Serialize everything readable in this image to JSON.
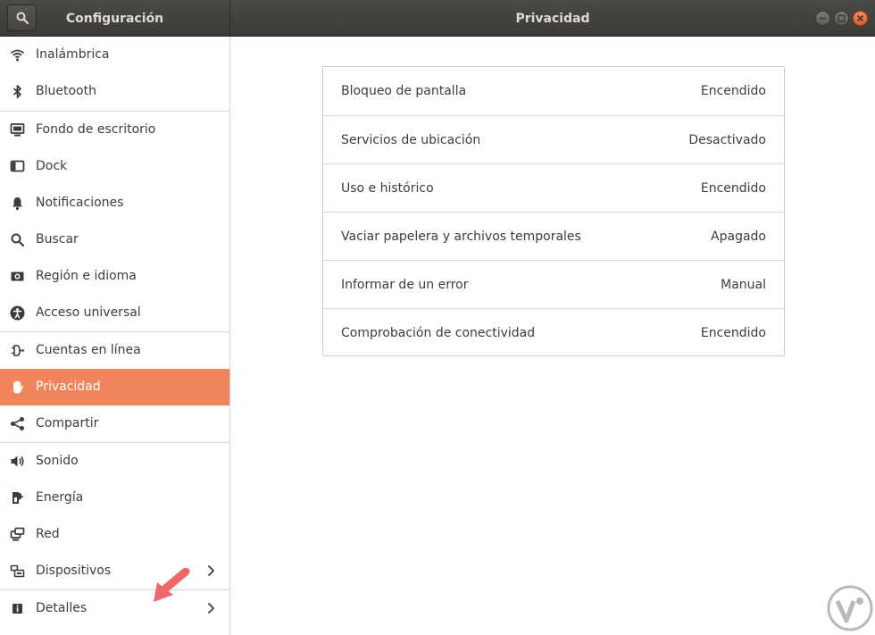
{
  "header": {
    "app_title": "Configuración",
    "panel_title": "Privacidad"
  },
  "sidebar": {
    "items": [
      {
        "label": "Inalámbrica",
        "icon": "wifi-icon"
      },
      {
        "label": "Bluetooth",
        "icon": "bluetooth-icon"
      },
      {
        "label": "Fondo de escritorio",
        "icon": "wallpaper-icon"
      },
      {
        "label": "Dock",
        "icon": "dock-icon"
      },
      {
        "label": "Notificaciones",
        "icon": "bell-icon"
      },
      {
        "label": "Buscar",
        "icon": "search-icon"
      },
      {
        "label": "Región e idioma",
        "icon": "region-icon"
      },
      {
        "label": "Acceso universal",
        "icon": "accessibility-icon"
      },
      {
        "label": "Cuentas en línea",
        "icon": "online-accounts-icon"
      },
      {
        "label": "Privacidad",
        "icon": "hand-icon",
        "active": true
      },
      {
        "label": "Compartir",
        "icon": "share-icon"
      },
      {
        "label": "Sonido",
        "icon": "speaker-icon"
      },
      {
        "label": "Energía",
        "icon": "power-icon"
      },
      {
        "label": "Red",
        "icon": "network-icon"
      },
      {
        "label": "Dispositivos",
        "icon": "devices-icon",
        "has_children": true
      },
      {
        "label": "Detalles",
        "icon": "info-icon",
        "has_children": true
      }
    ]
  },
  "privacy": {
    "rows": [
      {
        "label": "Bloqueo de pantalla",
        "value": "Encendido"
      },
      {
        "label": "Servicios de ubicación",
        "value": "Desactivado"
      },
      {
        "label": "Uso e histórico",
        "value": "Encendido"
      },
      {
        "label": "Vaciar papelera y archivos temporales",
        "value": "Apagado"
      },
      {
        "label": "Informar de un error",
        "value": "Manual"
      },
      {
        "label": "Comprobación de conectividad",
        "value": "Encendido"
      }
    ]
  },
  "colors": {
    "accent": "#f0845a",
    "headerbar": "#3c3b37",
    "close_button": "#e45e2a"
  }
}
